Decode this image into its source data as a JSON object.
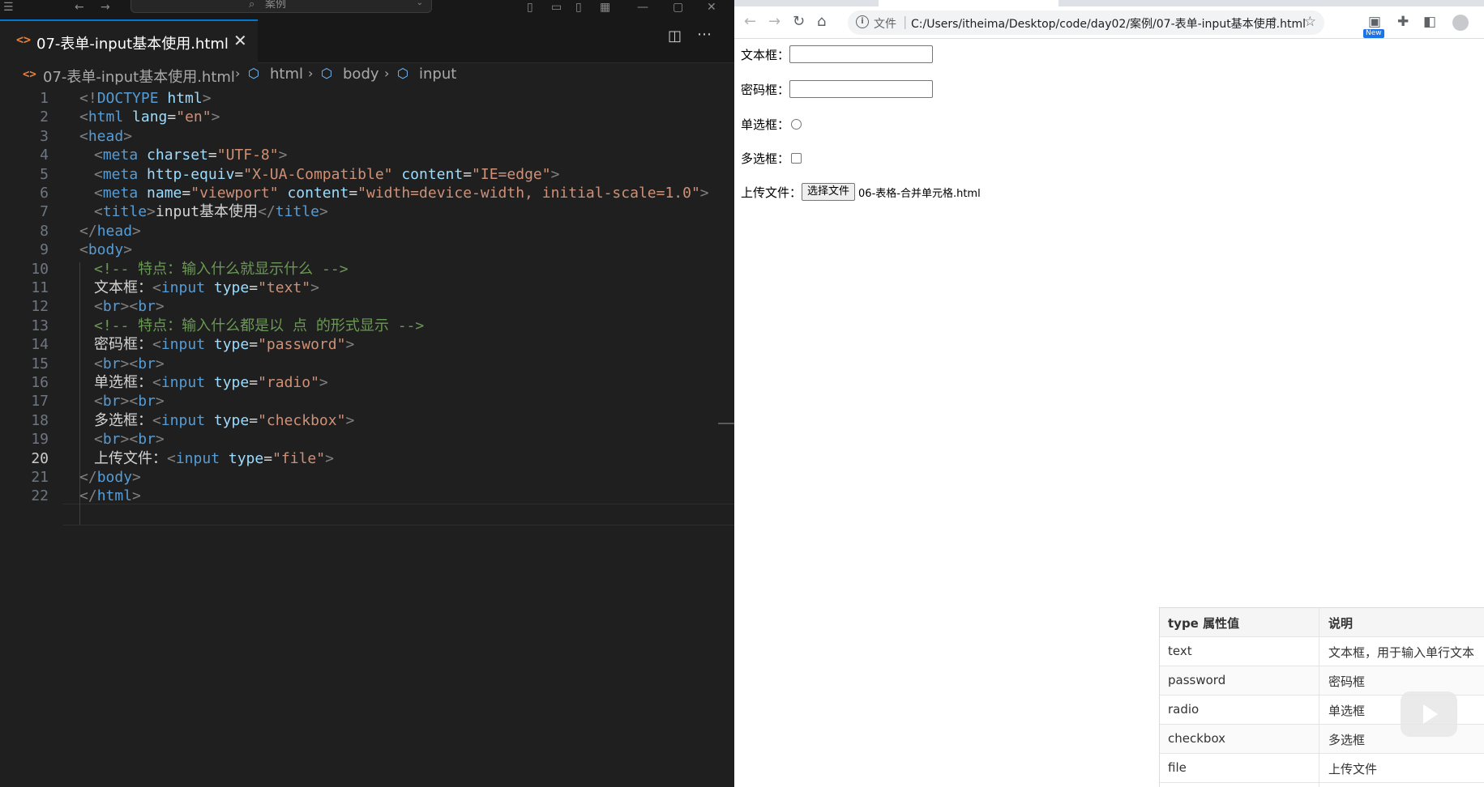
{
  "vscode": {
    "command_center": "案例",
    "tab": {
      "file_icon": "<>",
      "name": "07-表单-input基本使用.html",
      "close": "✕"
    },
    "breadcrumb": [
      "07-表单-input基本使用.html",
      "html",
      "body",
      "input"
    ],
    "line_numbers": [
      "1",
      "2",
      "3",
      "4",
      "5",
      "6",
      "7",
      "8",
      "9",
      "10",
      "11",
      "12",
      "13",
      "14",
      "15",
      "16",
      "17",
      "18",
      "19",
      "20",
      "21",
      "22"
    ],
    "current_line": "20",
    "code": {
      "l1": [
        "<!",
        "DOCTYPE",
        " html",
        ">"
      ],
      "l2": [
        "<",
        "html",
        " lang",
        "=",
        "\"en\"",
        ">"
      ],
      "l3": [
        "<",
        "head",
        ">"
      ],
      "l4": [
        "<",
        "meta",
        " charset",
        "=",
        "\"UTF-8\"",
        ">"
      ],
      "l5": [
        "<",
        "meta",
        " http-equiv",
        "=",
        "\"X-UA-Compatible\"",
        " content",
        "=",
        "\"IE=edge\"",
        ">"
      ],
      "l6": [
        "<",
        "meta",
        " name",
        "=",
        "\"viewport\"",
        " content",
        "=",
        "\"width=device-width, initial-scale=1.0\"",
        ">"
      ],
      "l7": [
        "<",
        "title",
        ">",
        "input基本使用",
        "</",
        "title",
        ">"
      ],
      "l8": [
        "</",
        "head",
        ">"
      ],
      "l9": [
        "<",
        "body",
        ">"
      ],
      "l10": [
        "<!-- 特点：输入什么就显示什么 -->"
      ],
      "l11": [
        "文本框：",
        "<",
        "input",
        " type",
        "=",
        "\"text\"",
        ">"
      ],
      "l12": [
        "<",
        "br",
        "><",
        "br",
        ">"
      ],
      "l13": [
        "<!-- 特点：输入什么都是以 点 的形式显示 -->"
      ],
      "l14": [
        "密码框：",
        "<",
        "input",
        " type",
        "=",
        "\"password\"",
        ">"
      ],
      "l15": [
        "<",
        "br",
        "><",
        "br",
        ">"
      ],
      "l16": [
        "单选框：",
        "<",
        "input",
        " type",
        "=",
        "\"radio\"",
        ">"
      ],
      "l17": [
        "<",
        "br",
        "><",
        "br",
        ">"
      ],
      "l18": [
        "多选框：",
        "<",
        "input",
        " type",
        "=",
        "\"checkbox\"",
        ">"
      ],
      "l19": [
        "<",
        "br",
        "><",
        "br",
        ">"
      ],
      "l20": [
        "上传文件：",
        "<",
        "input",
        " type",
        "=",
        "\"file\"",
        ">"
      ],
      "l21": [
        "</",
        "body",
        ">"
      ],
      "l22": [
        "</",
        "html",
        ">"
      ]
    }
  },
  "chrome": {
    "omnibox": {
      "label": "文件",
      "separator": "|",
      "url": "C:/Users/itheima/Desktop/code/day02/案例/07-表单-input基本使用.html"
    },
    "new_badge": "New",
    "page": {
      "text_label": "文本框：",
      "password_label": "密码框：",
      "radio_label": "单选框：",
      "checkbox_label": "多选框：",
      "file_label": "上传文件：",
      "file_button": "选择文件",
      "file_name": "06-表格-合并单元格.html"
    }
  },
  "overlay_table": {
    "headers": [
      "type 属性值",
      "说明"
    ],
    "rows": [
      [
        "text",
        "文本框，用于输入单行文本"
      ],
      [
        "password",
        "密码框"
      ],
      [
        "radio",
        "单选框"
      ],
      [
        "checkbox",
        "多选框"
      ],
      [
        "file",
        "上传文件"
      ]
    ]
  },
  "colors": {
    "accent": "#0078d4",
    "tag": "#569cd6",
    "attr": "#9cdcfe",
    "string": "#ce9178",
    "comment": "#6a9955"
  }
}
